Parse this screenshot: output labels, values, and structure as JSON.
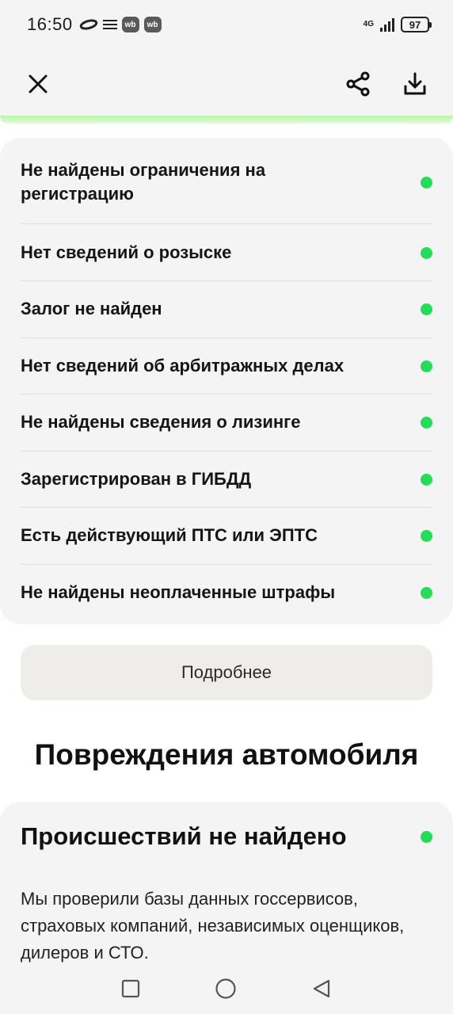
{
  "status_bar": {
    "time": "16:50",
    "wb_badge_1": "wb",
    "wb_badge_2": "wb",
    "network": "4G",
    "battery": "97"
  },
  "header": {
    "close_icon": "close-icon",
    "share_icon": "share-icon",
    "download_icon": "download-icon"
  },
  "checks": {
    "items": [
      {
        "label": "Не найдены ограничения на регистрацию",
        "status_color": "#22dd55"
      },
      {
        "label": "Нет сведений о розыске",
        "status_color": "#22dd55"
      },
      {
        "label": "Залог не найден",
        "status_color": "#22dd55"
      },
      {
        "label": "Нет сведений об арбитражных делах",
        "status_color": "#22dd55"
      },
      {
        "label": "Не найдены сведения о лизинге",
        "status_color": "#22dd55"
      },
      {
        "label": "Зарегистрирован в ГИБДД",
        "status_color": "#22dd55"
      },
      {
        "label": "Есть действующий ПТС или ЭПТС",
        "status_color": "#22dd55"
      },
      {
        "label": "Не найдены неоплаченные штрафы",
        "status_color": "#22dd55"
      }
    ]
  },
  "more_button": "Подробнее",
  "damage_section": {
    "title": "Повреждения автомобиля",
    "incident_title": "Происшествий не найдено",
    "incident_text": "Мы проверили базы данных госсервисов, страховых компаний, независимых оценщиков, дилеров и СТО."
  },
  "nav_bar": {
    "recent_icon": "square-icon",
    "home_icon": "circle-icon",
    "back_icon": "back-triangle-icon"
  },
  "colors": {
    "accent_green": "#22dd55",
    "card_bg": "#f4f4f4",
    "button_bg": "#efedea"
  }
}
